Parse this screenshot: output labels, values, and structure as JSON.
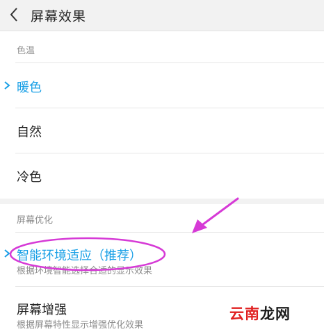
{
  "header": {
    "title": "屏幕效果",
    "back_icon": "chevron-left-icon"
  },
  "color_temperature": {
    "section_label": "色温",
    "options": [
      {
        "label": "暖色",
        "selected": true
      },
      {
        "label": "自然",
        "selected": false
      },
      {
        "label": "冷色",
        "selected": false
      }
    ]
  },
  "screen_optimization": {
    "section_label": "屏幕优化",
    "options": [
      {
        "label": "智能环境适应（推荐）",
        "subtitle": "根据环境智能选择合适的显示效果",
        "selected": true
      },
      {
        "label": "屏幕增强",
        "subtitle": "根据屏幕特性显示增强优化效果",
        "selected": false
      }
    ]
  },
  "colors": {
    "accent": "#1aa0e6",
    "annotation": "#d63ad6",
    "header_bg": "#f2f2f2"
  },
  "watermark": {
    "text_red": "云南",
    "text_dark": "龙网"
  }
}
